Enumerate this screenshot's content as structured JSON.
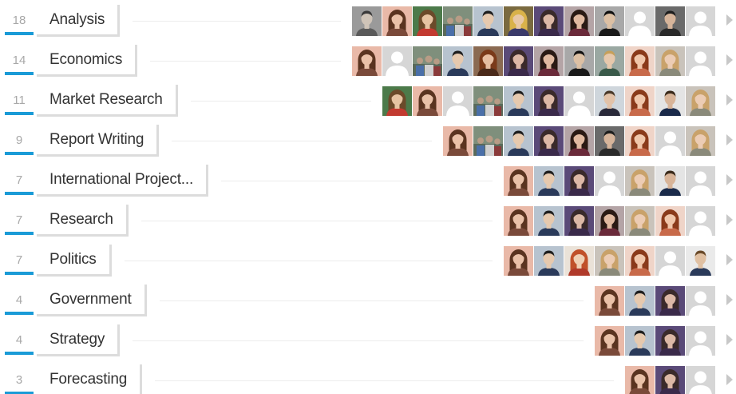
{
  "skills": [
    {
      "count": "18",
      "name": "Analysis",
      "endorsers": [
        "man-gray",
        "woman-brown",
        "woman-green",
        "crowd",
        "man-asian",
        "blonde-woman",
        "woman-purple",
        "woman-dark",
        "man-asian-2",
        "placeholder",
        "man-dark",
        "placeholder"
      ]
    },
    {
      "count": "14",
      "name": "Economics",
      "endorsers": [
        "woman-brown",
        "placeholder",
        "crowd",
        "man-asian",
        "woman-red",
        "woman-purple",
        "woman-dark",
        "man-asian-2",
        "man-blonde",
        "woman-red-2",
        "woman-blonde",
        "placeholder"
      ]
    },
    {
      "count": "11",
      "name": "Market Research",
      "endorsers": [
        "woman-green",
        "woman-brown",
        "placeholder",
        "crowd",
        "man-asian",
        "woman-purple",
        "placeholder",
        "man-suit",
        "woman-red-2",
        "man-beard",
        "woman-blonde"
      ]
    },
    {
      "count": "9",
      "name": "Report Writing",
      "endorsers": [
        "woman-brown",
        "crowd",
        "man-asian",
        "woman-purple",
        "woman-dark",
        "man-dark",
        "woman-red-2",
        "placeholder",
        "woman-blonde"
      ]
    },
    {
      "count": "7",
      "name": "International Project...",
      "endorsers": [
        "woman-brown",
        "man-asian",
        "woman-purple",
        "placeholder",
        "woman-blonde",
        "man-beard",
        "placeholder"
      ]
    },
    {
      "count": "7",
      "name": "Research",
      "endorsers": [
        "woman-brown",
        "man-asian",
        "woman-purple",
        "woman-dark",
        "woman-blonde",
        "woman-red-2",
        "placeholder"
      ]
    },
    {
      "count": "7",
      "name": "Politics",
      "endorsers": [
        "woman-brown",
        "man-asian",
        "woman-redhair",
        "woman-blonde",
        "woman-red-2",
        "placeholder",
        "man-beard-2"
      ]
    },
    {
      "count": "4",
      "name": "Government",
      "endorsers": [
        "woman-brown",
        "man-asian",
        "woman-purple",
        "placeholder"
      ]
    },
    {
      "count": "4",
      "name": "Strategy",
      "endorsers": [
        "woman-brown",
        "man-asian",
        "woman-purple",
        "placeholder"
      ]
    },
    {
      "count": "3",
      "name": "Forecasting",
      "endorsers": [
        "woman-brown",
        "woman-purple",
        "placeholder"
      ]
    }
  ],
  "colors": {
    "accent": "#1a9bd7",
    "count_text": "#a8a8a8",
    "name_text": "#333333"
  }
}
